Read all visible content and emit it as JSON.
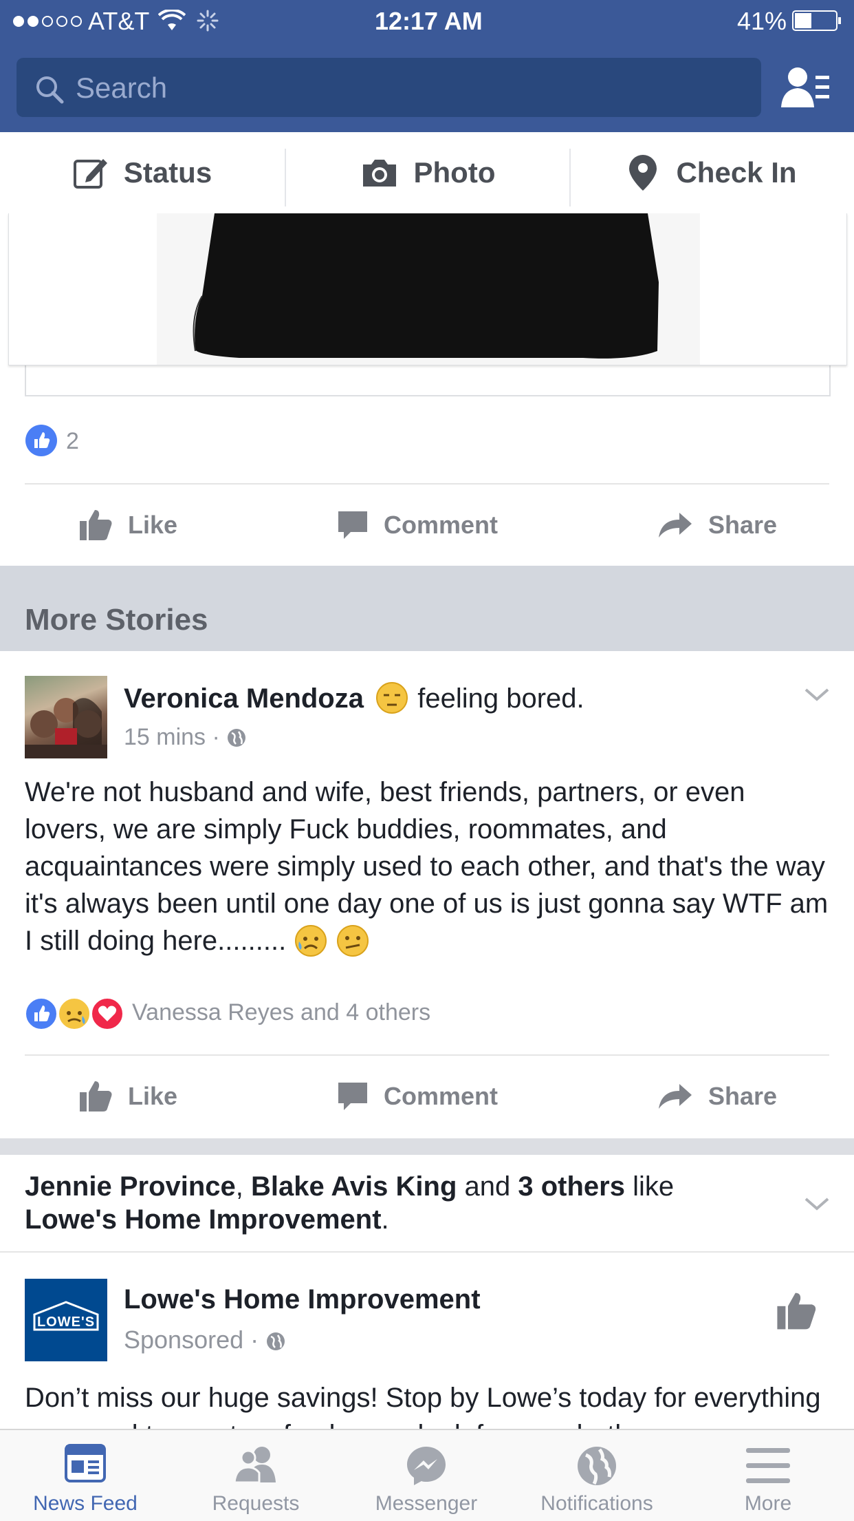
{
  "status_bar": {
    "carrier": "AT&T",
    "time": "12:17 AM",
    "battery": "41%",
    "battery_level": 0.41
  },
  "header": {
    "search_placeholder": "Search"
  },
  "composer": {
    "status_label": "Status",
    "photo_label": "Photo",
    "checkin_label": "Check In"
  },
  "post1": {
    "like_count": "2",
    "actions": {
      "like": "Like",
      "comment": "Comment",
      "share": "Share"
    }
  },
  "section": {
    "title": "More Stories"
  },
  "post2": {
    "author": "Veronica Mendoza",
    "feeling": "feeling bored.",
    "time": "15 mins",
    "dot": "·",
    "text": "We're not husband and wife, best friends, partners, or even lovers, we are simply Fuck buddies, roommates, and acquaintances were simply used to each other, and that's the way it's always been until one day one of us is just gonna say WTF am I still doing here.........",
    "reactions_text": "Vanessa Reyes and 4 others",
    "actions": {
      "like": "Like",
      "comment": "Comment",
      "share": "Share"
    }
  },
  "post3": {
    "social": {
      "name1": "Jennie Province",
      "sep1": ", ",
      "name2": "Blake Avis King",
      "and": " and ",
      "others": "3 others",
      "like": " like",
      "page": "Lowe's Home Improvement",
      "period": "."
    },
    "page_name": "Lowe's Home Improvement",
    "logo_text": "LOWE'S",
    "sponsored": "Sponsored",
    "dot": "·",
    "text": "Don’t miss our huge savings! Stop by Lowe’s today for everything you need to create a fresh, new look for your bath"
  },
  "tabbar": {
    "tabs": [
      {
        "label": "News Feed",
        "active": true
      },
      {
        "label": "Requests"
      },
      {
        "label": "Messenger"
      },
      {
        "label": "Notifications"
      },
      {
        "label": "More"
      }
    ]
  },
  "colors": {
    "brand": "#3b5998",
    "active_tab": "#4267b2",
    "muted": "#90949c"
  }
}
